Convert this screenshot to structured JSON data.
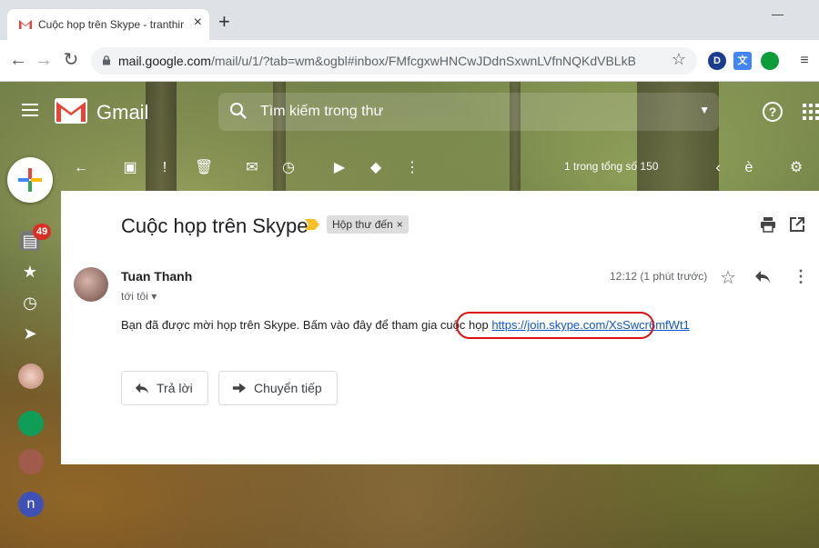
{
  "browser": {
    "tab_title": "Cuộc họp trên Skype - tranthima",
    "url_host": "mail.google.com",
    "url_path": "/mail/u/1/?tab=wm&ogbl#inbox/FMfcgxwHNCwJDdnSxwnLVfnNQKdVBLkB",
    "extension_d_letter": "D"
  },
  "gmail": {
    "app_name": "Gmail",
    "search_placeholder": "Tìm kiếm trong thư",
    "help_glyph": "?",
    "pager_text": "1 trong tổng số 150",
    "unread_badge": "49",
    "rail_avatar_letter": "n"
  },
  "message": {
    "subject": "Cuộc họp trên Skype",
    "label": "Hộp thư đến",
    "label_remove": "×",
    "sender": "Tuan Thanh",
    "to_line": "tới tôi",
    "timestamp": "12:12 (1 phút trước)",
    "body": "Bạn đã được mời họp trên Skype. Bấm vào đây để tham gia cuộc họp",
    "link": "https://join.skype.com/XsSwcr6mfWt1"
  },
  "actions": {
    "reply_label": "Trả lời",
    "forward_label": "Chuyển tiếp"
  },
  "icons": {
    "tab_favicon": "gmail-logo",
    "extensions": [
      "d-extension",
      "translate-extension",
      "green-circle-extension",
      "reading-list-icon"
    ],
    "rail": [
      "inbox-icon",
      "star-icon",
      "clock-icon",
      "label-icon",
      "chat-icon"
    ]
  },
  "colors": {
    "gmail_red": "#EA4335",
    "link_blue": "#1155cc",
    "highlight_red": "#d11111",
    "badge_red": "#d93025"
  }
}
